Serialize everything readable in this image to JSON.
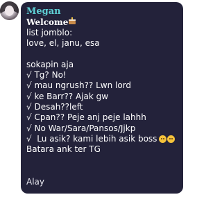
{
  "message": {
    "sender": "Megan",
    "welcome": "Welcome",
    "welcome_icon": "cake-icon",
    "lines": [
      "list jomblo:",
      "love, el, janu, esa",
      "",
      "sokapin aja",
      "√ Tg? No!",
      "√ mau ngrush?? Lwn lord",
      "√ ke Barr?? Ajak gw",
      "√ Desah??left",
      "√ Cpan?? Peje anj peje lahhh",
      "√ No War/Sara/Pansos/Jjkp",
      "√  Lu asik? kami lebih asik boss",
      "Batara ank ter TG"
    ],
    "line_emojis": [
      "grimacing-face-icon",
      "face-icon"
    ],
    "footer": "Alay"
  },
  "colors": {
    "bubble_background": "#23223a",
    "sender_name": "#5fd1d6",
    "text": "#ffffff"
  }
}
